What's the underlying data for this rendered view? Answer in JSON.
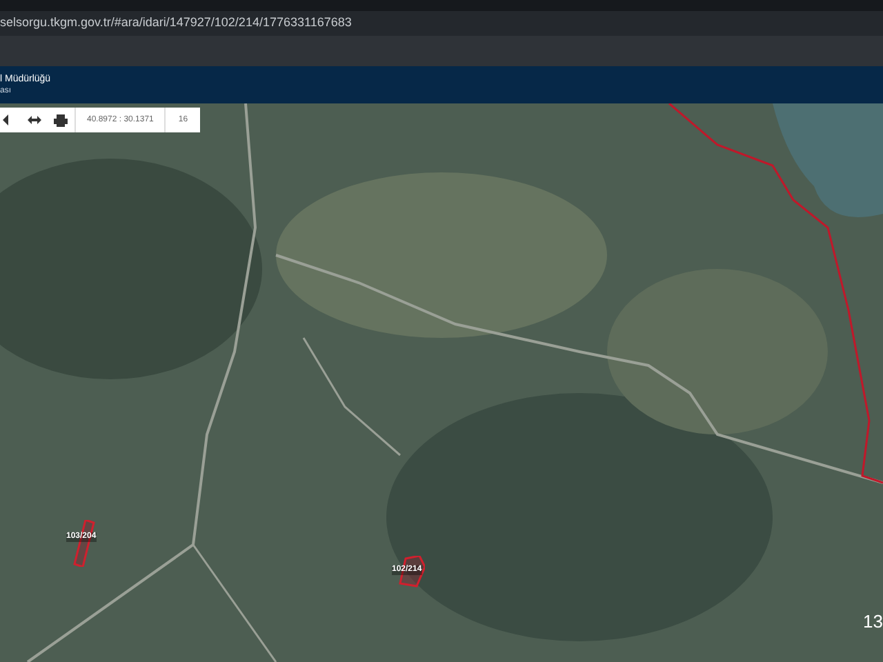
{
  "browser": {
    "url": "selsorgu.tkgm.gov.tr/#ara/idari/147927/102/214/1776331167683"
  },
  "header": {
    "title": "l Müdürlüğü",
    "subtitle": "ası"
  },
  "toolbar": {
    "coordinates": "40.8972 : 30.1371",
    "zoom": "16"
  },
  "map": {
    "parcels": [
      {
        "label": "103/204"
      },
      {
        "label": "102/214"
      }
    ],
    "corner_text": "13"
  }
}
